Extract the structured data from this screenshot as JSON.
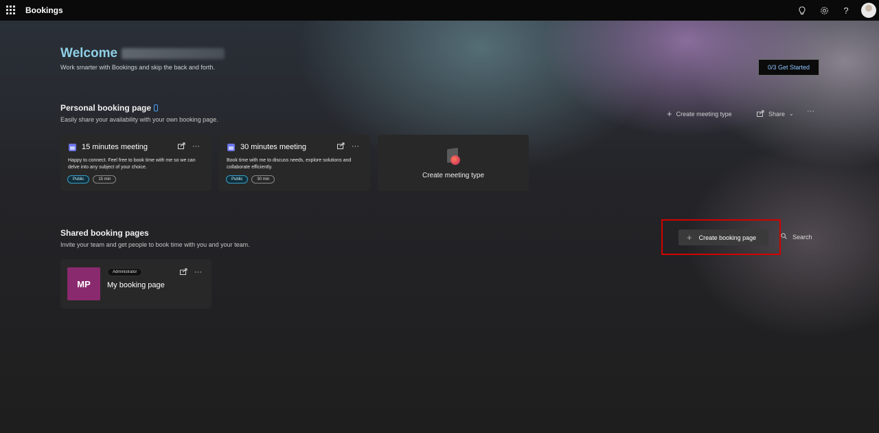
{
  "topbar": {
    "app_name": "Bookings",
    "icons": [
      "waffle-icon",
      "lightbulb-icon",
      "gear-icon",
      "help-icon",
      "avatar"
    ]
  },
  "hero": {
    "welcome": "Welcome",
    "subtitle": "Work smarter with Bookings and skip the back and forth.",
    "get_started_progress": "0/3",
    "get_started_label": "Get Started"
  },
  "personal": {
    "title": "Personal booking page",
    "subtitle": "Easily share your availability with your own booking page.",
    "actions": {
      "create_meeting_type": "Create meeting type",
      "share": "Share",
      "more": "···"
    },
    "cards": [
      {
        "title": "15 minutes meeting",
        "description": "Happy to connect. Feel free to book time with me so we can delve into any subject of your choice.",
        "visibility": "Public",
        "duration": "15 min"
      },
      {
        "title": "30 minutes meeting",
        "description": "Book time with me to discuss needs, explore solutions and collaborate efficiently.",
        "visibility": "Public",
        "duration": "30 min"
      }
    ],
    "create_card_label": "Create meeting type"
  },
  "shared": {
    "title": "Shared booking pages",
    "subtitle": "Invite your team and get people to book time with you and your team.",
    "create_button": "Create booking page",
    "search_label": "Search",
    "pages": [
      {
        "initials": "MP",
        "role": "Administrator",
        "name": "My booking page",
        "color": "#8a2a6e"
      }
    ]
  },
  "colors": {
    "accent_welcome": "#8fd0e6",
    "get_started_text": "#8ec6ff",
    "highlight": "#d40000"
  }
}
